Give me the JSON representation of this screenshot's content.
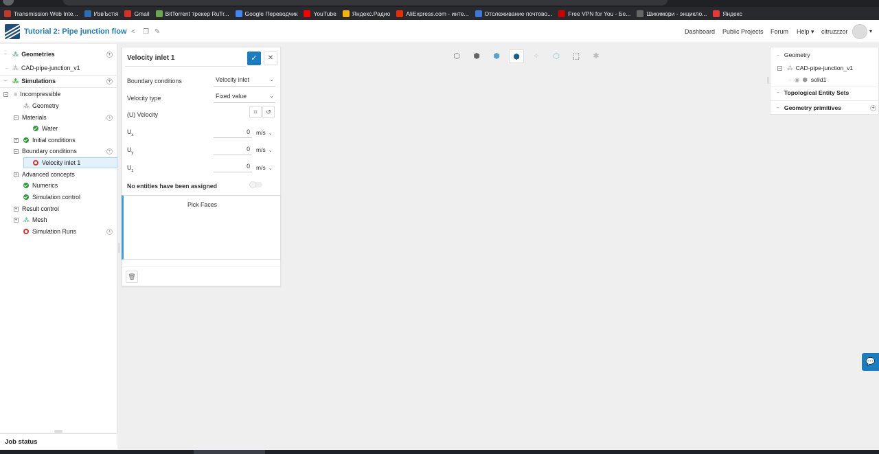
{
  "browser": {
    "bookmarks": [
      {
        "label": "Transmission Web Inte...",
        "color": "#c0392b"
      },
      {
        "label": "ИзвЪстія",
        "color": "#2c6fb3"
      },
      {
        "label": "Gmail",
        "color": "#d93025"
      },
      {
        "label": "BitTorrent трекер RuTr...",
        "color": "#6aa84f"
      },
      {
        "label": "Google Переводчик",
        "color": "#4285f4"
      },
      {
        "label": "YouTube",
        "color": "#ff0000"
      },
      {
        "label": "Яндекс.Радио",
        "color": "#f4b400"
      },
      {
        "label": "AliExpress.com - инте...",
        "color": "#e62e04"
      },
      {
        "label": "Отслеживание почтово...",
        "color": "#3c78d8"
      },
      {
        "label": "Free VPN for You - Бе...",
        "color": "#cc0000"
      },
      {
        "label": "Шикимори - энцикло...",
        "color": "#666666"
      },
      {
        "label": "Яндекс",
        "color": "#e53935"
      }
    ]
  },
  "header": {
    "project_title": "Tutorial 2: Pipe junction flow",
    "nav": [
      "Dashboard",
      "Public Projects",
      "Forum",
      "Help"
    ],
    "username": "citruzzzor",
    "accent": "#1a7cc1"
  },
  "tree": {
    "geometries": "Geometries",
    "cad": "CAD-pipe-junction_v1",
    "simulations": "Simulations",
    "incompressible": "Incompressible",
    "geometry": "Geometry",
    "materials": "Materials",
    "water": "Water",
    "initial_conditions": "Initial conditions",
    "boundary_conditions": "Boundary conditions",
    "velocity_inlet": "Velocity inlet 1",
    "advanced_concepts": "Advanced concepts",
    "numerics": "Numerics",
    "simulation_control": "Simulation control",
    "result_control": "Result control",
    "mesh": "Mesh",
    "simulation_runs": "Simulation Runs",
    "job_status": "Job status"
  },
  "panel": {
    "title": "Velocity inlet 1",
    "boundary_conditions_label": "Boundary conditions",
    "boundary_conditions_value": "Velocity inlet",
    "velocity_type_label": "Velocity type",
    "velocity_type_value": "Fixed value",
    "velocity_label": "(U) Velocity",
    "ux_label": "U",
    "ux_sub": "x",
    "ux_value": "0",
    "uy_label": "U",
    "uy_sub": "y",
    "uy_value": "0",
    "uz_label": "U",
    "uz_sub": "z",
    "uz_value": "0",
    "unit": "m/s",
    "no_entities": "No entities have been assigned",
    "pick_faces": "Pick Faces"
  },
  "right": {
    "geometry": "Geometry",
    "cad": "CAD-pipe-junction_v1",
    "solid": "solid1",
    "topological": "Topological Entity Sets",
    "primitives": "Geometry primitives"
  }
}
